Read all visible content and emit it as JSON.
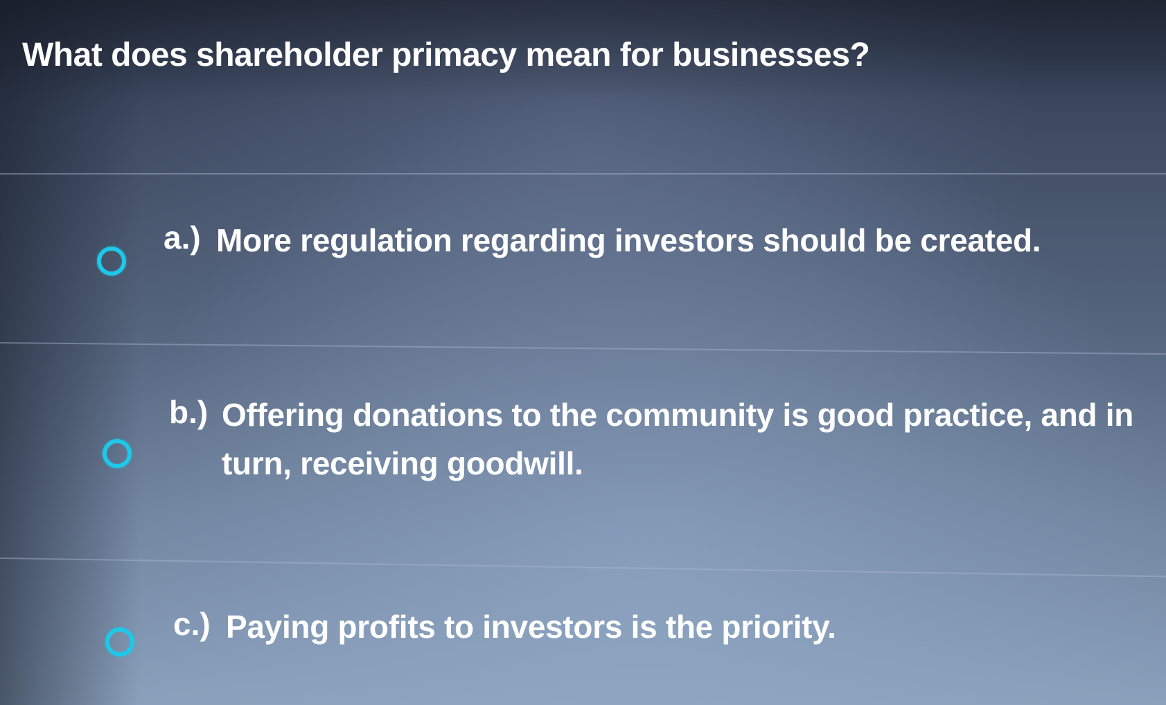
{
  "question": {
    "text": "What does shareholder primacy mean for businesses?"
  },
  "options": [
    {
      "letter": "a.)",
      "text": "More regulation regarding investors should be created.",
      "selected": false
    },
    {
      "letter": "b.)",
      "text": "Offering donations to the community is good practice, and in turn, receiving goodwill.",
      "selected": false
    },
    {
      "letter": "c.)",
      "text": "Paying profits to investors is the priority.",
      "selected": false
    }
  ],
  "colors": {
    "radio_accent": "#1ec8e8",
    "text": "#ffffff",
    "background_top": "#2b3446",
    "background_bottom": "#8aa0bb"
  },
  "icons": {
    "radio": "radio-unselected-icon"
  }
}
